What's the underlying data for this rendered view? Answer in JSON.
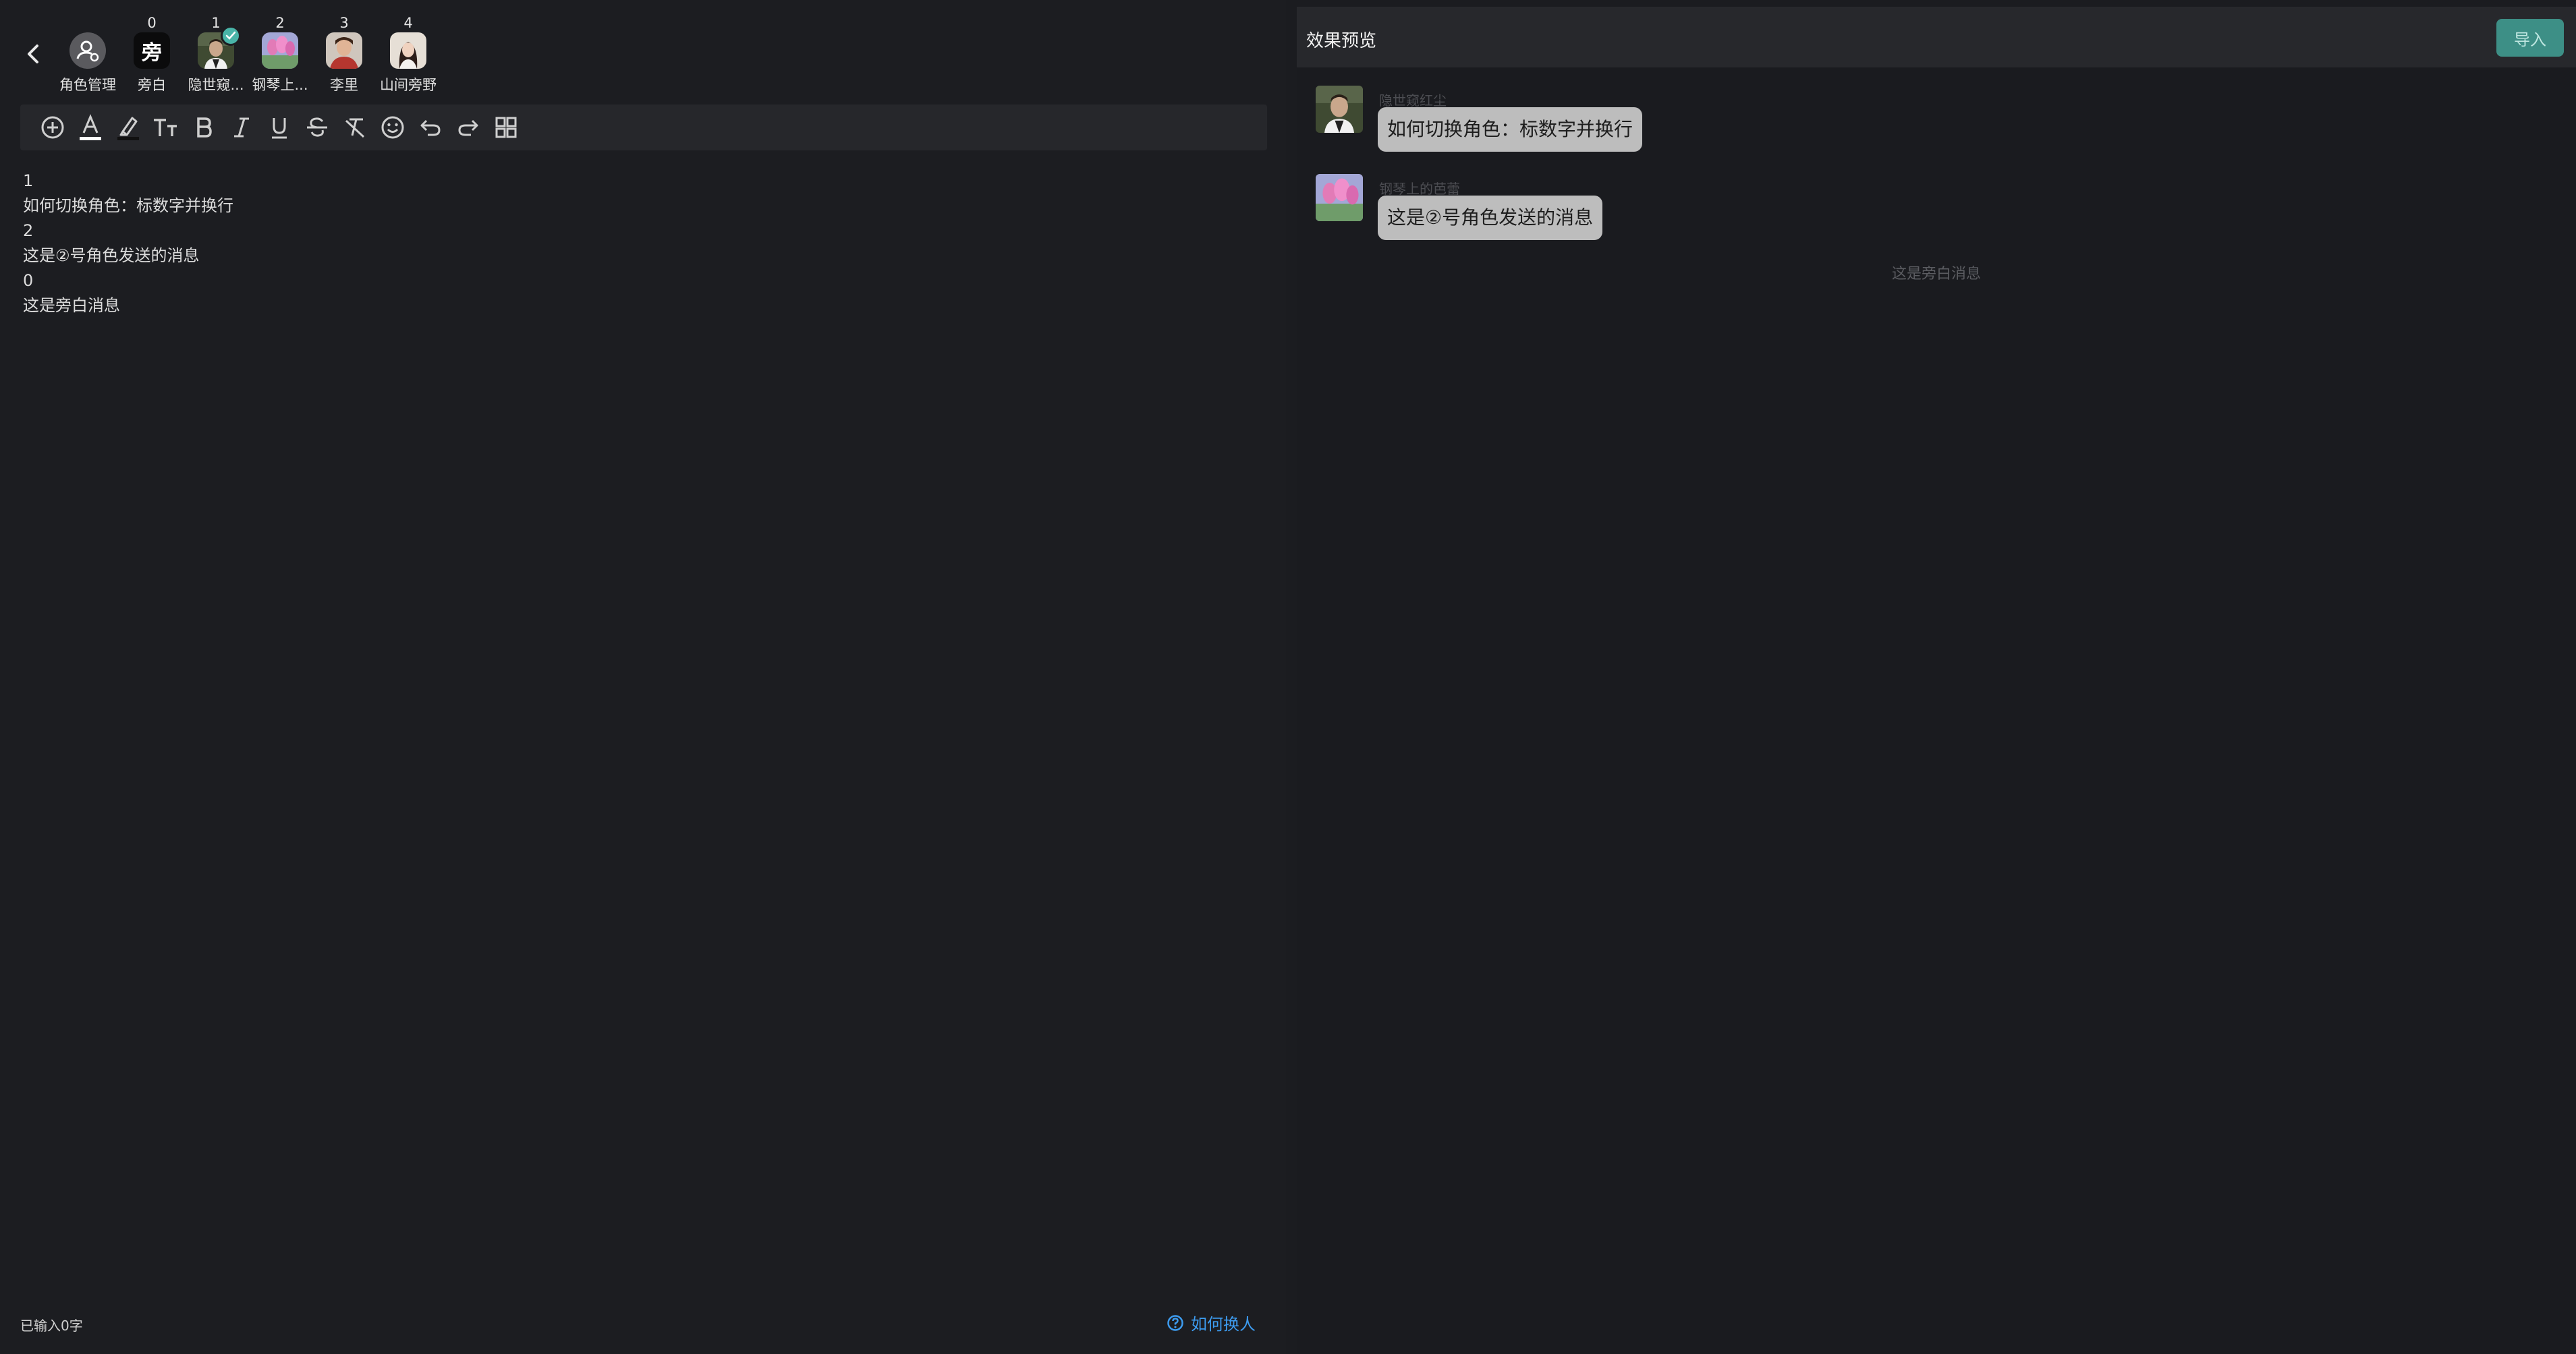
{
  "editor": {
    "roles": [
      {
        "num": "",
        "label": "角色管理",
        "kind": "manager",
        "icon": "user-gear-icon"
      },
      {
        "num": "0",
        "label": "旁白",
        "kind": "narrator",
        "glyph": "旁"
      },
      {
        "num": "1",
        "label": "隐世窥...",
        "kind": "avatar",
        "selected": true,
        "icon": "check-icon"
      },
      {
        "num": "2",
        "label": "钢琴上...",
        "kind": "avatar"
      },
      {
        "num": "3",
        "label": "李里",
        "kind": "avatar"
      },
      {
        "num": "4",
        "label": "山间旁野",
        "kind": "avatar"
      }
    ],
    "toolbar_icons": [
      "add-icon",
      "font-color-icon",
      "highlight-icon",
      "font-size-icon",
      "bold-icon",
      "italic-icon",
      "underline-icon",
      "strikethrough-icon",
      "clear-format-icon",
      "emoji-icon",
      "undo-icon",
      "redo-icon",
      "grid-icon"
    ],
    "lines": [
      "1",
      "如何切换角色：标数字并换行",
      "2",
      "这是②号角色发送的消息",
      "0",
      "这是旁白消息"
    ],
    "char_count": "已输入0字",
    "help_link": "如何换人"
  },
  "preview": {
    "title": "效果预览",
    "import_label": "导入",
    "messages": [
      {
        "name": "隐世窥红尘",
        "text": "如何切换角色：标数字并换行"
      },
      {
        "name": "钢琴上的芭蕾",
        "text": "这是②号角色发送的消息"
      }
    ],
    "narration": "这是旁白消息"
  },
  "colors": {
    "background": "#1c1d21",
    "toolbar": "#26272b",
    "accent": "#3d8f86",
    "link": "#3d9cf0",
    "bubble": "#bdbdbd",
    "selected_badge": "#49b4a8"
  }
}
